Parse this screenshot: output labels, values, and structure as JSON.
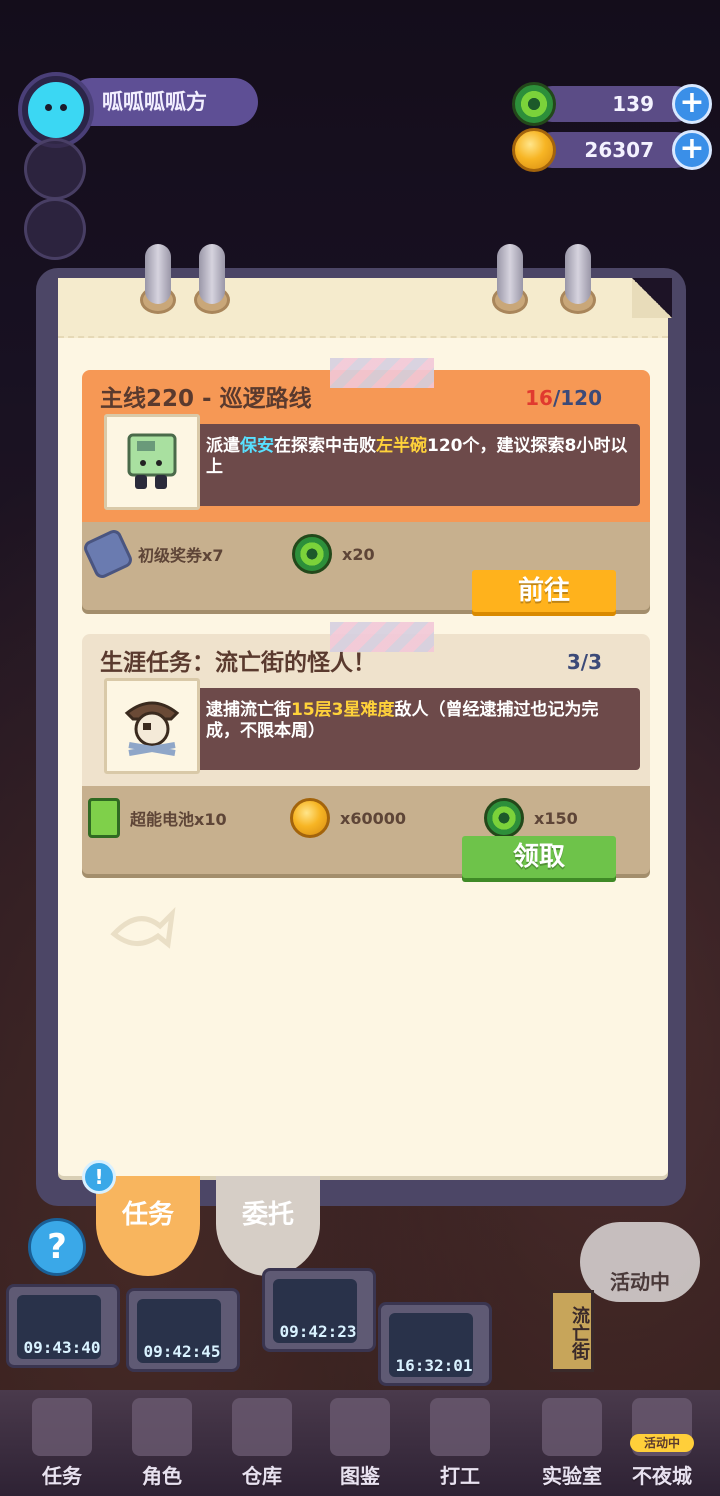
{
  "player": {
    "name": "呱呱呱呱方"
  },
  "currencies": [
    {
      "icon": "green-donut-coin-icon",
      "amount": "139"
    },
    {
      "icon": "gold-coin-icon",
      "amount": "26307"
    }
  ],
  "quests": {
    "main": {
      "title": "主线220 - 巡逻路线",
      "progress_current": "16",
      "progress_total": "/120",
      "desc_a": "派遣",
      "desc_role": "保安",
      "desc_b": "在探索中击败",
      "desc_enemy": "左半碗",
      "desc_c": "120个，建议探索8小时以上",
      "rewards": [
        {
          "icon": "ticket-icon",
          "label": "初级奖券x7"
        },
        {
          "icon": "green-donut-coin-icon",
          "label": "x20"
        }
      ],
      "button": "前往"
    },
    "career": {
      "title": "生涯任务：流亡街的怪人！",
      "progress": "3/3",
      "desc_a": "逮捕流亡街",
      "desc_hl": "15层3星难度",
      "desc_b": "敌人（曾经逮捕过也记为完成，不限本周）",
      "rewards": [
        {
          "icon": "battery-icon",
          "label": "超能电池x10"
        },
        {
          "icon": "gold-coin-icon",
          "label": "x60000"
        },
        {
          "icon": "green-donut-coin-icon",
          "label": "x150"
        }
      ],
      "button": "领取"
    }
  },
  "tabs": {
    "active": "任务",
    "other": "委托",
    "badge": "!"
  },
  "timers": [
    "09:43:40",
    "09:42:45",
    "09:42:23",
    "16:32:01"
  ],
  "event": {
    "bubble": "活动中",
    "street_sign": "流亡街"
  },
  "help": "?",
  "nav": [
    {
      "label": "任务"
    },
    {
      "label": "角色"
    },
    {
      "label": "仓库"
    },
    {
      "label": "图鉴"
    },
    {
      "label": "打工"
    },
    {
      "label": "实验室"
    },
    {
      "label": "不夜城",
      "tag": "活动中"
    }
  ]
}
